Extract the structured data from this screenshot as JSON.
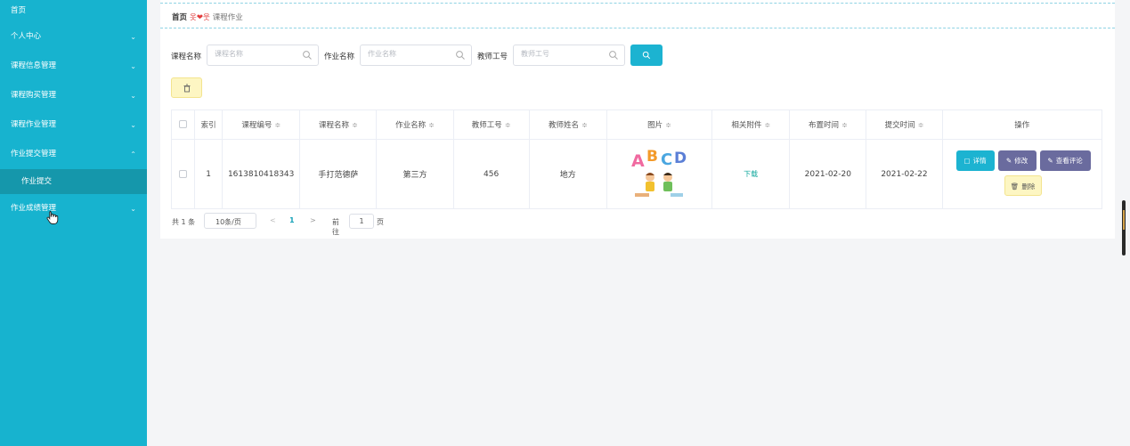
{
  "sidebar": {
    "top_label": "首页",
    "items": [
      {
        "label": "个人中心"
      },
      {
        "label": "课程信息管理"
      },
      {
        "label": "课程购买管理"
      },
      {
        "label": "课程作业管理"
      },
      {
        "label": "作业提交管理"
      },
      {
        "label": "作业成绩管理"
      }
    ],
    "sub_item": "作业提交",
    "chevron_down": "⌄",
    "chevron_up": "⌃"
  },
  "breadcrumb": {
    "home": "首页",
    "sep": "옷❤웃",
    "current": "课程作业"
  },
  "search": {
    "course_name_label": "课程名称",
    "course_name_placeholder": "课程名称",
    "homework_name_label": "作业名称",
    "homework_name_placeholder": "作业名称",
    "teacher_id_label": "教师工号",
    "teacher_id_placeholder": "教师工号"
  },
  "table": {
    "headers": [
      "索引",
      "课程编号",
      "课程名称",
      "作业名称",
      "教师工号",
      "教师姓名",
      "图片",
      "相关附件",
      "布置时间",
      "提交时间",
      "操作"
    ],
    "sort_glyph": "≑",
    "row": {
      "index": "1",
      "course_no": "1613810418343",
      "course_name": "手打范德萨",
      "homework_name": "第三方",
      "teacher_id": "456",
      "teacher_name": "地方",
      "image_letters": [
        "A",
        "B",
        "C",
        "D"
      ],
      "attachment": "下载",
      "assigned_time": "2021-02-20",
      "submit_time": "2021-02-22"
    },
    "actions": {
      "detail": "详情",
      "edit": "修改",
      "comment": "查看评论",
      "delete": "删除"
    }
  },
  "pagination": {
    "total": "共 1 条",
    "page_size": "10条/页",
    "prev": "<",
    "current_page": "1",
    "next": ">",
    "goto_label": "前往",
    "goto_value": "1",
    "page_label": "页"
  },
  "colors": {
    "sidebar": "#17b3cf",
    "sidebar_active": "#1597ab",
    "detail_button": "#1cb3d1",
    "edit_button": "#6a6b9e",
    "comment_button": "#6a6b9e",
    "delete_button": "#fdf6c3",
    "accent_link": "#13a89e"
  }
}
